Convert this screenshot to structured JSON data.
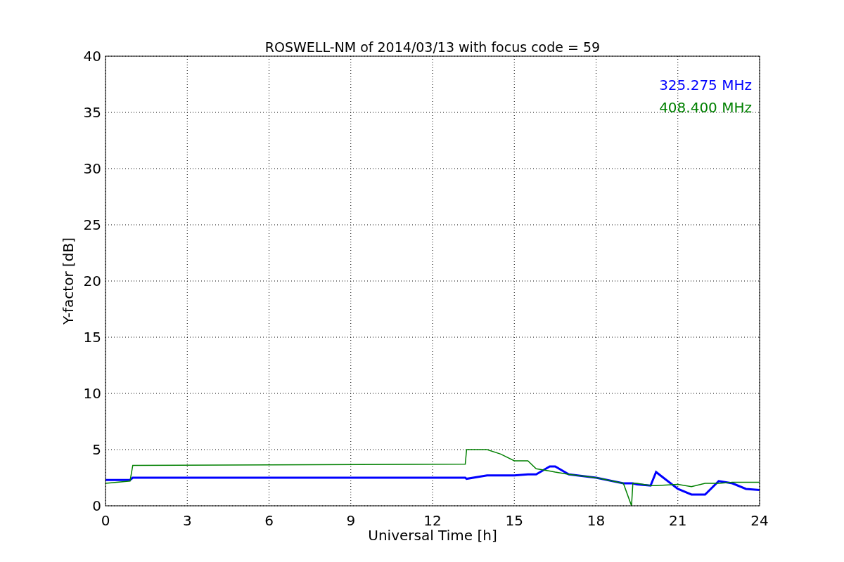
{
  "figure": {
    "chart_data": {
      "type": "line",
      "title": "ROSWELL-NM of 2014/03/13 with focus code = 59",
      "xlabel": "Universal Time [h]",
      "ylabel": "Y-factor [dB]",
      "x": [
        0,
        0.9,
        1,
        13.2,
        13.25,
        14,
        14.5,
        15,
        15.5,
        15.8,
        16.3,
        16.5,
        17,
        18,
        19,
        19.3,
        19.35,
        19.5,
        20,
        20.2,
        21,
        21.5,
        22,
        22.5,
        23,
        23.5,
        24
      ],
      "series": [
        {
          "name": "325.275 MHz",
          "color": "#0000ff",
          "values": [
            2.3,
            2.3,
            2.5,
            2.5,
            2.4,
            2.7,
            2.7,
            2.7,
            2.8,
            2.8,
            3.5,
            3.5,
            2.8,
            2.5,
            2.0,
            2.0,
            2.0,
            1.9,
            1.8,
            3.0,
            1.5,
            1.0,
            1.0,
            2.2,
            2.0,
            1.5,
            1.4
          ]
        },
        {
          "name": "408.400 MHz",
          "color": "#008000",
          "values": [
            2.0,
            2.2,
            3.6,
            3.7,
            5.0,
            5.0,
            4.6,
            4.0,
            4.0,
            3.3,
            3.1,
            3.0,
            2.8,
            2.5,
            2.0,
            0,
            2.0,
            2.0,
            1.8,
            1.8,
            1.9,
            1.7,
            2.0,
            2.0,
            2.1,
            2.1,
            2.1
          ]
        }
      ],
      "xlim": [
        0,
        24
      ],
      "ylim": [
        0,
        40
      ],
      "xticks": [
        0,
        3,
        6,
        9,
        12,
        15,
        18,
        21,
        24
      ],
      "yticks": [
        0,
        5,
        10,
        15,
        20,
        25,
        30,
        35,
        40
      ],
      "grid": true
    }
  }
}
